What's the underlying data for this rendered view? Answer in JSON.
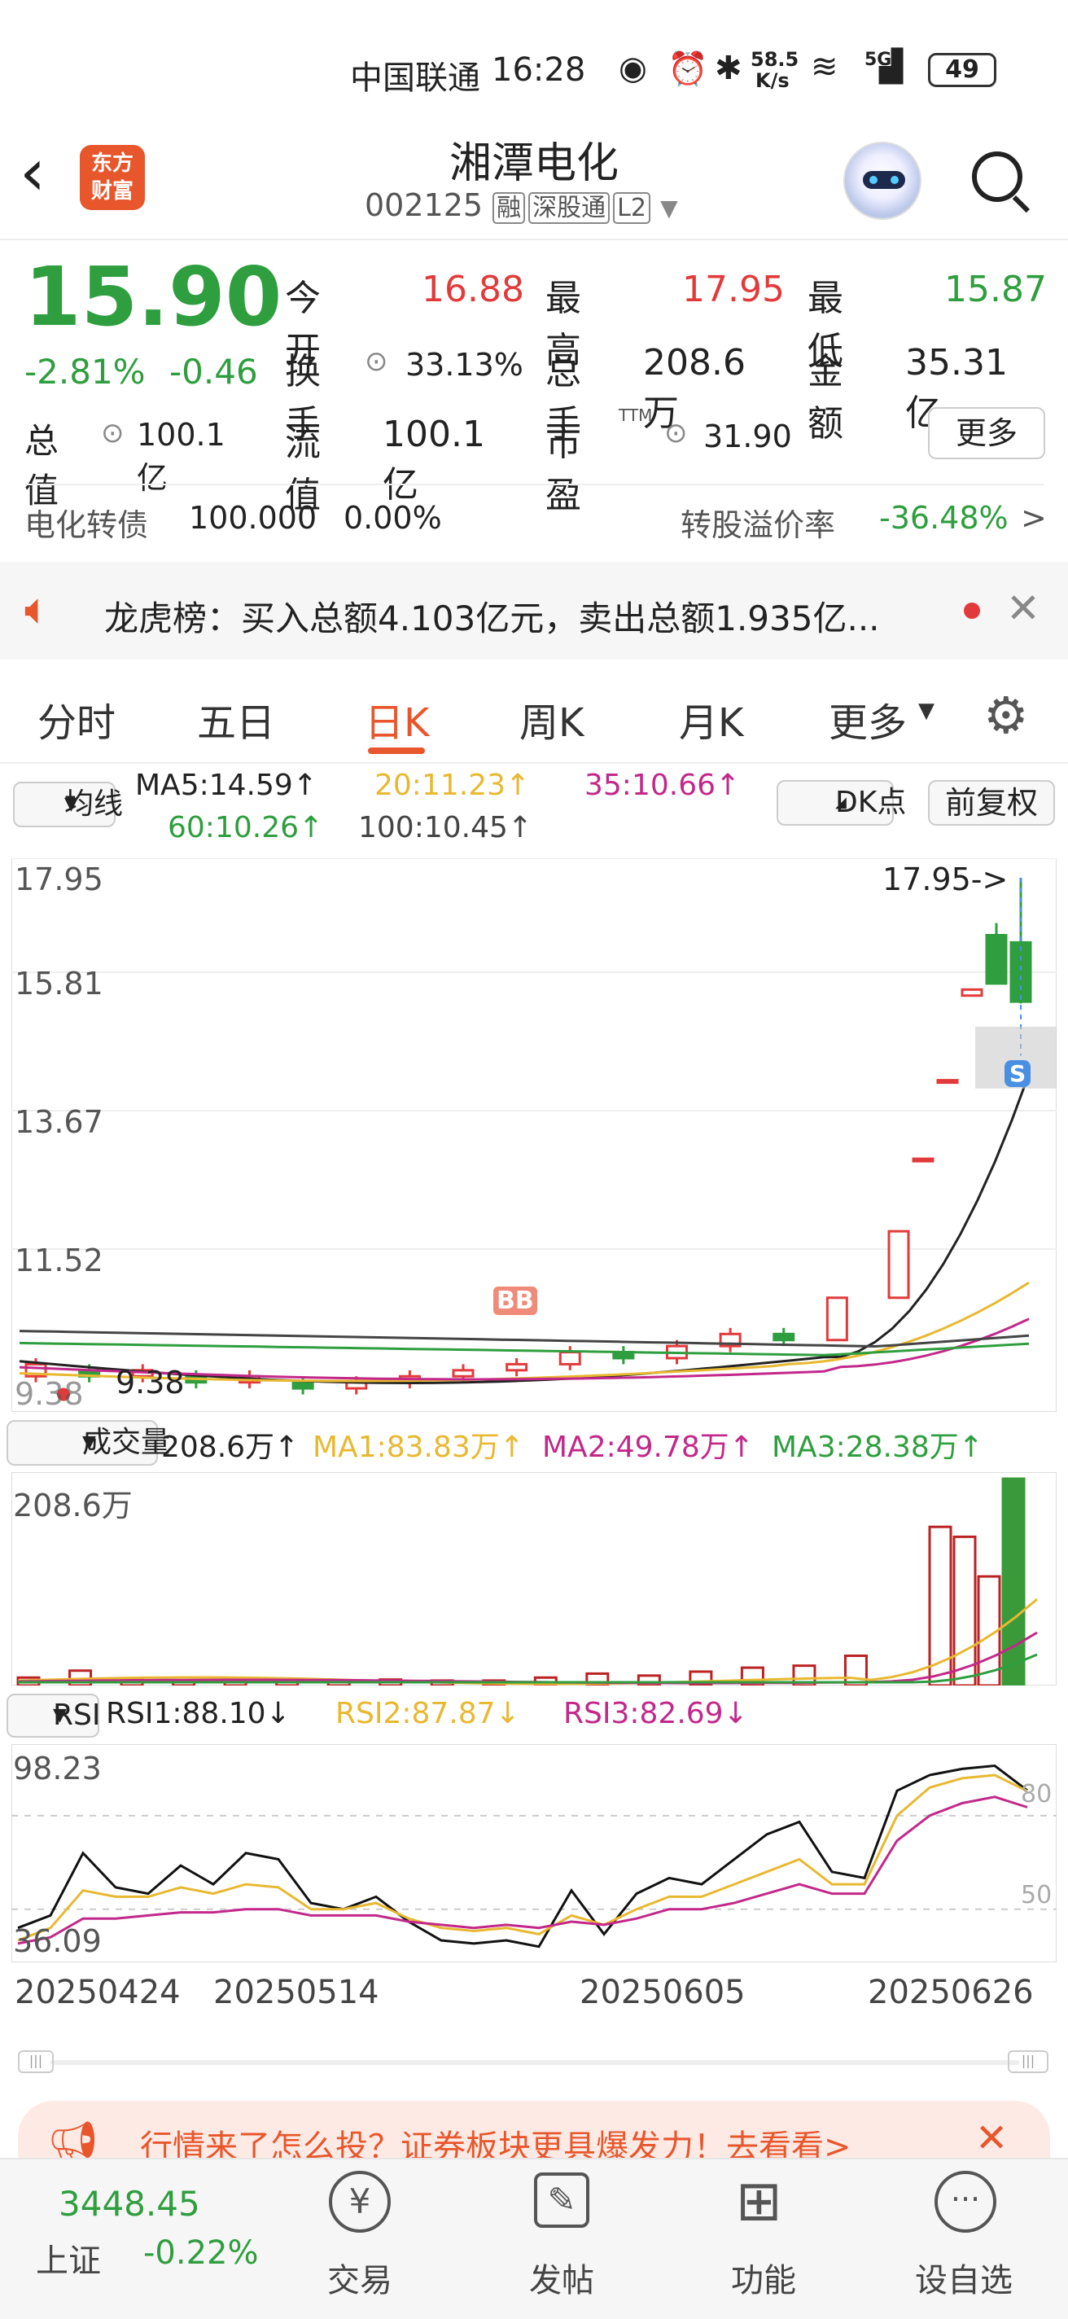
{
  "status": {
    "carrier": "中国联通",
    "time": "16:28",
    "net_speed": "58.5",
    "net_unit": "K/s",
    "signal": "5G",
    "battery": "49"
  },
  "header": {
    "logo_line1": "东方",
    "logo_line2": "财富",
    "name": "湘潭电化",
    "code": "002125",
    "tags": [
      "融",
      "深股通",
      "L2"
    ]
  },
  "quote": {
    "price": "15.90",
    "change_pct": "-2.81%",
    "change": "-0.46",
    "fields": [
      {
        "k": "今开",
        "v": "16.88"
      },
      {
        "k": "最高",
        "v": "17.95"
      },
      {
        "k": "最低",
        "v": "15.87"
      },
      {
        "k": "换手",
        "v": "33.13%"
      },
      {
        "k": "总手",
        "v": "208.6万"
      },
      {
        "k": "金额",
        "v": "35.31亿"
      },
      {
        "k": "总值",
        "v": "100.1亿"
      },
      {
        "k": "流值",
        "v": "100.1亿"
      },
      {
        "k": "市盈",
        "sup": "TTM",
        "v": "31.90"
      }
    ],
    "more": "更多"
  },
  "bond": {
    "name": "电化转债",
    "price": "100.000",
    "pct": "0.00%",
    "premium_label": "转股溢价率",
    "premium": "-36.48%",
    "arrow": ">"
  },
  "notice": {
    "text": "龙虎榜：买入总额4.103亿元，卖出总额1.935亿..."
  },
  "tabs": [
    "分时",
    "五日",
    "日K",
    "周K",
    "月K",
    "更多"
  ],
  "ma_legend": {
    "selector": "均线",
    "ma5": "MA5:14.59↑",
    "ma20": "20:11.23↑",
    "ma35": "35:10.66↑",
    "ma60": "60:10.26↑",
    "ma100": "100:10.45↑",
    "dk": "DK点",
    "fq": "前复权"
  },
  "kline": {
    "y_labels": [
      "17.95",
      "15.81",
      "13.67",
      "11.52",
      "9.38"
    ],
    "high_marker": "17.95->",
    "low_marker": "9.38",
    "b_marker": "BB",
    "s_marker": "S"
  },
  "volume": {
    "selector": "成交量",
    "vol": "208.6万↑",
    "ma1": "MA1:83.83万↑",
    "ma2": "MA2:49.78万↑",
    "ma3": "MA3:28.38万↑",
    "max_label": "208.6万"
  },
  "rsi": {
    "selector": "RSI",
    "rsi1": "RSI1:88.10↓",
    "rsi2": "RSI2:87.87↓",
    "rsi3": "RSI3:82.69↓",
    "top": "98.23",
    "bottom": "36.09",
    "l80": "80",
    "l50": "50"
  },
  "dates": [
    "20250424",
    "20250514",
    "20250605",
    "20250626"
  ],
  "ad": {
    "text": "行情来了怎么投？证券板块更具爆发力！去看看>"
  },
  "bottom": {
    "index_value": "3448.45",
    "index_name": "上证",
    "index_pct": "-0.22%",
    "items": [
      "交易",
      "发帖",
      "功能",
      "设自选"
    ]
  },
  "chart_data": [
    {
      "type": "candlestick",
      "title": "日K",
      "ylim": [
        9.38,
        17.95
      ],
      "x": [
        "20250424",
        "20250514",
        "20250605",
        "20250626"
      ],
      "ma": {
        "MA5": 14.59,
        "MA20": 11.23,
        "MA35": 10.66,
        "MA60": 10.26,
        "MA100": 10.45
      },
      "candles": [
        {
          "o": 9.7,
          "c": 9.9,
          "h": 10.0,
          "l": 9.6
        },
        {
          "o": 9.8,
          "c": 9.7,
          "h": 9.9,
          "l": 9.6
        },
        {
          "o": 9.7,
          "c": 9.8,
          "h": 9.9,
          "l": 9.6
        },
        {
          "o": 9.7,
          "c": 9.6,
          "h": 9.8,
          "l": 9.5
        },
        {
          "o": 9.6,
          "c": 9.7,
          "h": 9.8,
          "l": 9.5
        },
        {
          "o": 9.6,
          "c": 9.5,
          "h": 9.7,
          "l": 9.4
        },
        {
          "o": 9.5,
          "c": 9.6,
          "h": 9.7,
          "l": 9.4
        },
        {
          "o": 9.6,
          "c": 9.7,
          "h": 9.8,
          "l": 9.5
        },
        {
          "o": 9.7,
          "c": 9.8,
          "h": 9.9,
          "l": 9.6
        },
        {
          "o": 9.8,
          "c": 9.9,
          "h": 10.0,
          "l": 9.7
        },
        {
          "o": 9.9,
          "c": 10.1,
          "h": 10.2,
          "l": 9.8
        },
        {
          "o": 10.1,
          "c": 10.0,
          "h": 10.2,
          "l": 9.9
        },
        {
          "o": 10.0,
          "c": 10.2,
          "h": 10.3,
          "l": 9.9
        },
        {
          "o": 10.2,
          "c": 10.4,
          "h": 10.5,
          "l": 10.1
        },
        {
          "o": 10.4,
          "c": 10.3,
          "h": 10.5,
          "l": 10.2
        },
        {
          "o": 10.3,
          "c": 11.0,
          "h": 11.0,
          "l": 10.3
        },
        {
          "o": 11.0,
          "c": 12.1,
          "h": 12.1,
          "l": 11.0
        },
        {
          "o": 13.3,
          "c": 13.3,
          "h": 13.3,
          "l": 13.3
        },
        {
          "o": 14.6,
          "c": 14.6,
          "h": 14.6,
          "l": 14.6
        },
        {
          "o": 16.0,
          "c": 16.1,
          "h": 16.1,
          "l": 16.0
        },
        {
          "o": 17.0,
          "c": 16.2,
          "h": 17.2,
          "l": 16.2
        },
        {
          "o": 16.88,
          "c": 15.9,
          "h": 17.95,
          "l": 15.87
        }
      ]
    },
    {
      "type": "bar",
      "title": "成交量",
      "ylim": [
        0,
        208.6
      ],
      "unit": "万",
      "values": [
        8,
        15,
        6,
        5,
        4,
        5,
        4,
        6,
        5,
        5,
        8,
        12,
        10,
        14,
        18,
        20,
        30,
        160,
        150,
        110,
        208.6
      ],
      "ma_lines": {
        "MA1": 83.83,
        "MA2": 49.78,
        "MA3": 28.38
      }
    },
    {
      "type": "line",
      "title": "RSI",
      "ylim": [
        36.09,
        98.23
      ],
      "reference_lines": [
        50,
        80
      ],
      "series": [
        {
          "name": "RSI1",
          "values": [
            44,
            48,
            68,
            57,
            55,
            64,
            58,
            68,
            66,
            52,
            50,
            54,
            46,
            40,
            39,
            40,
            38,
            56,
            42,
            55,
            60,
            58,
            66,
            74,
            78,
            62,
            60,
            88,
            93,
            95,
            96,
            88.1
          ]
        },
        {
          "name": "RSI2",
          "values": [
            40,
            44,
            56,
            54,
            54,
            57,
            55,
            58,
            57,
            50,
            50,
            52,
            47,
            44,
            43,
            44,
            42,
            48,
            45,
            50,
            54,
            54,
            58,
            62,
            66,
            58,
            58,
            80,
            89,
            92,
            93,
            87.87
          ]
        },
        {
          "name": "RSI3",
          "values": [
            39,
            41,
            47,
            47,
            48,
            49,
            49,
            50,
            50,
            48,
            48,
            48,
            46,
            45,
            44,
            45,
            44,
            46,
            45,
            47,
            50,
            50,
            52,
            55,
            58,
            55,
            55,
            72,
            80,
            84,
            86,
            82.69
          ]
        }
      ]
    }
  ]
}
